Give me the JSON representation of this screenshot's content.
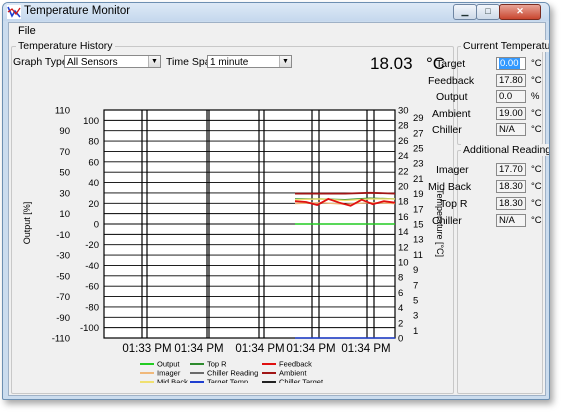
{
  "window": {
    "title": "Temperature Monitor"
  },
  "menu": {
    "file": "File"
  },
  "history": {
    "group_title": "Temperature History",
    "graph_type_label": "Graph Type:",
    "graph_type_value": "All Sensors",
    "time_span_label": "Time Span:",
    "time_span_value": "1 minute",
    "current_reading": "18.03",
    "current_unit": "°C"
  },
  "current_temperature": {
    "group_title": "Current Temperature",
    "rows": [
      {
        "label": "Target",
        "value": "0.00",
        "unit": "°C"
      },
      {
        "label": "Feedback",
        "value": "17.80",
        "unit": "°C"
      },
      {
        "label": "Output",
        "value": "0.0",
        "unit": "%"
      },
      {
        "label": "Ambient",
        "value": "19.00",
        "unit": "°C"
      },
      {
        "label": "Chiller",
        "value": "N/A",
        "unit": "°C"
      }
    ]
  },
  "additional_readings": {
    "group_title": "Additional Readings",
    "rows": [
      {
        "label": "Imager",
        "value": "17.70",
        "unit": "°C"
      },
      {
        "label": "Mid Back",
        "value": "18.30",
        "unit": "°C"
      },
      {
        "label": "Top R",
        "value": "18.30",
        "unit": "°C"
      },
      {
        "label": "Chiller",
        "value": "N/A",
        "unit": "°C"
      }
    ]
  },
  "chart_data": {
    "type": "line",
    "left_axis": {
      "label": "Output [%]",
      "ticks_inner": [
        100,
        80,
        60,
        40,
        20,
        0,
        -20,
        -40,
        -60,
        -80,
        -100
      ],
      "ticks_outer": [
        110,
        90,
        70,
        50,
        30,
        10,
        -10,
        -30,
        -50,
        -70,
        -90,
        -110
      ],
      "range": [
        -110,
        110
      ]
    },
    "right_axis": {
      "label": "Temperature [°C]",
      "ticks_outer": [
        30,
        28,
        26,
        24,
        22,
        20,
        18,
        16,
        14,
        12,
        10,
        8,
        6,
        4,
        2,
        0
      ],
      "ticks_inner": [
        29,
        27,
        25,
        23,
        21,
        19,
        17,
        15,
        13,
        11,
        9,
        7,
        5,
        3,
        1
      ],
      "range": [
        0,
        30
      ]
    },
    "x_tick_labels": [
      "01:33 PM",
      "01:34 PM",
      "01:34 PM",
      "01:34 PM",
      "01:34 PM"
    ],
    "grid": true,
    "legend_position": "bottom",
    "legend": [
      {
        "name": "Output",
        "color": "#22cc22"
      },
      {
        "name": "Imager",
        "color": "#f0b87a"
      },
      {
        "name": "Mid Back",
        "color": "#f0e070"
      },
      {
        "name": "Top R",
        "color": "#2e8b2e"
      },
      {
        "name": "Chiller Reading",
        "color": "#6a6a6a"
      },
      {
        "name": "Target Temp",
        "color": "#1f3fd0"
      },
      {
        "name": "Feedback",
        "color": "#e01010"
      },
      {
        "name": "Ambient",
        "color": "#a01515"
      },
      {
        "name": "Chiller Target",
        "color": "#222222"
      }
    ],
    "series": [
      {
        "name": "Output",
        "axis": "left",
        "color": "#22cc22",
        "y": [
          0,
          0,
          0,
          0,
          0
        ]
      },
      {
        "name": "Target Temp",
        "axis": "right",
        "color": "#1f3fd0",
        "y": [
          0,
          0,
          0,
          0,
          0
        ]
      },
      {
        "name": "Ambient",
        "axis": "right",
        "color": "#a01515",
        "y": [
          19.0,
          19.0,
          19.0,
          19.1,
          19.0
        ]
      },
      {
        "name": "Top R",
        "axis": "right",
        "color": "#2e8b2e",
        "y": [
          18.3,
          18.3,
          18.2,
          18.4,
          18.3
        ]
      },
      {
        "name": "Mid Back",
        "axis": "right",
        "color": "#f0e070",
        "y": [
          18.2,
          18.3,
          18.1,
          18.3,
          18.3
        ]
      },
      {
        "name": "Imager",
        "axis": "right",
        "color": "#f0b87a",
        "y": [
          17.7,
          17.8,
          17.6,
          17.8,
          17.7
        ]
      },
      {
        "name": "Feedback",
        "axis": "right",
        "color": "#e01010",
        "y": [
          18.0,
          17.9,
          17.5,
          18.3,
          17.8,
          17.4,
          18.2,
          17.6,
          18.0,
          17.8
        ]
      }
    ]
  }
}
